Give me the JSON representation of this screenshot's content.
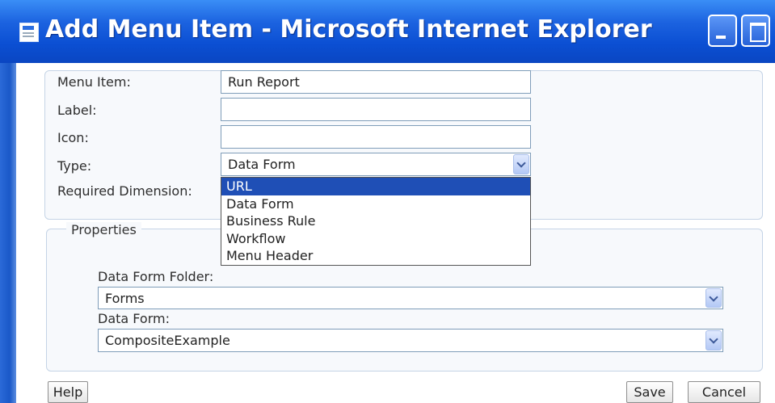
{
  "window": {
    "title": "Add Menu Item - Microsoft Internet Explorer"
  },
  "form": {
    "menu_item": {
      "label": "Menu Item:",
      "value": "Run Report"
    },
    "label_field": {
      "label": "Label:",
      "value": ""
    },
    "icon_field": {
      "label": "Icon:",
      "value": ""
    },
    "type_field": {
      "label": "Type:",
      "value": "Data Form"
    },
    "required_dimension": {
      "label": "Required Dimension:"
    }
  },
  "type_dropdown": {
    "options": [
      "URL",
      "Data Form",
      "Business Rule",
      "Workflow",
      "Menu Header"
    ],
    "highlighted": "URL"
  },
  "properties": {
    "legend": "Properties",
    "folder": {
      "label": "Data Form Folder:",
      "value": "Forms"
    },
    "data_form": {
      "label": "Data Form:",
      "value": "CompositeExample"
    }
  },
  "buttons": {
    "help": "Help",
    "save": "Save",
    "cancel": "Cancel"
  }
}
